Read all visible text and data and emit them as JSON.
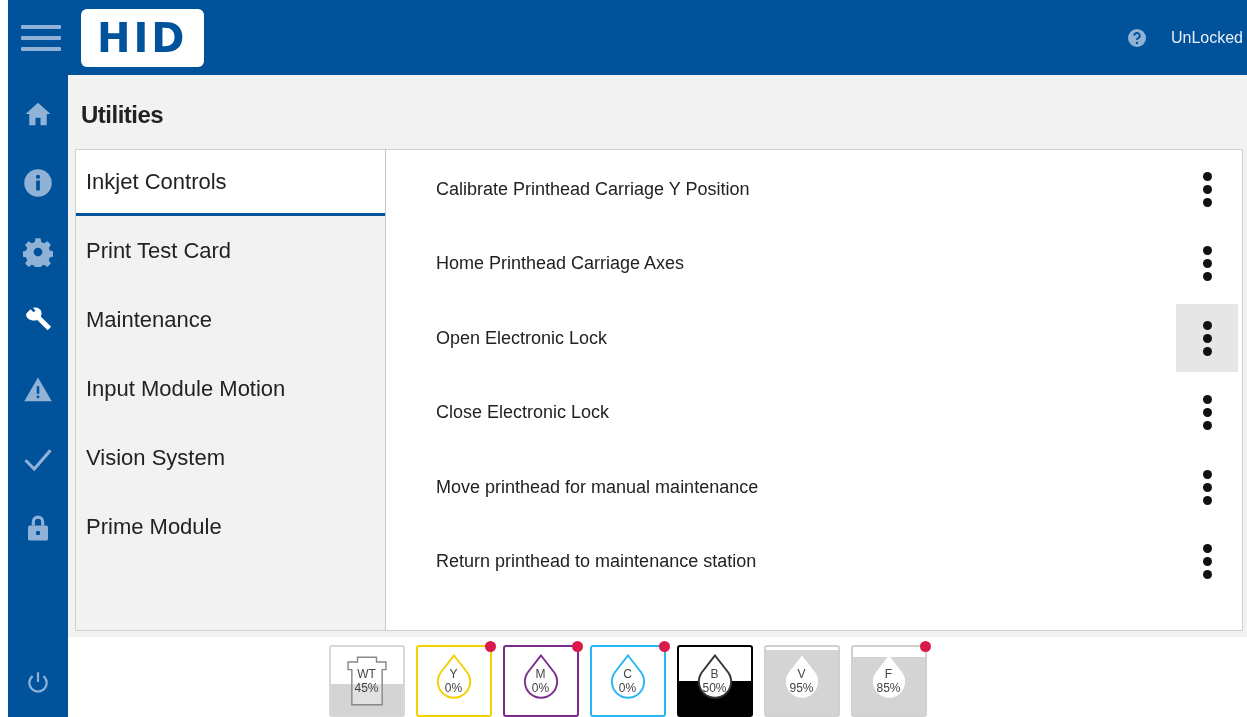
{
  "header": {
    "logo": "HID",
    "status": "UnLocked"
  },
  "sidebar": {
    "items": [
      {
        "kind": "home",
        "selected": false
      },
      {
        "kind": "info",
        "selected": false
      },
      {
        "kind": "settings",
        "selected": false
      },
      {
        "kind": "wrench",
        "selected": true
      },
      {
        "kind": "warning",
        "selected": false
      },
      {
        "kind": "check",
        "selected": false
      },
      {
        "kind": "lock",
        "selected": false
      }
    ]
  },
  "page": {
    "title": "Utilities"
  },
  "tabs": [
    {
      "label": "Inkjet Controls",
      "selected": true
    },
    {
      "label": "Print Test Card",
      "selected": false
    },
    {
      "label": "Maintenance",
      "selected": false
    },
    {
      "label": "Input Module Motion",
      "selected": false
    },
    {
      "label": "Vision System",
      "selected": false
    },
    {
      "label": "Prime Module",
      "selected": false
    }
  ],
  "actions": [
    {
      "label": "Calibrate Printhead Carriage Y Position",
      "hovered": false
    },
    {
      "label": "Home Printhead Carriage Axes",
      "hovered": false
    },
    {
      "label": "Open Electronic Lock",
      "hovered": true
    },
    {
      "label": "Close Electronic Lock",
      "hovered": false
    },
    {
      "label": "Move printhead for manual maintenance",
      "hovered": false
    },
    {
      "label": "Return printhead to maintenance station",
      "hovered": false
    }
  ],
  "supplies": [
    {
      "kind": "tank",
      "code": "WT",
      "reading": "45%",
      "color": "#d8d8d8",
      "alert": false
    },
    {
      "kind": "drop",
      "code": "Y",
      "reading": "0%",
      "color": "#f5d000",
      "alert": true
    },
    {
      "kind": "drop",
      "code": "M",
      "reading": "0%",
      "color": "#7b2d8e",
      "alert": true
    },
    {
      "kind": "drop",
      "code": "C",
      "reading": "0%",
      "color": "#29b6f6",
      "alert": true
    },
    {
      "kind": "drop",
      "code": "B",
      "reading": "50%",
      "color": "#000000",
      "alert": false
    },
    {
      "kind": "drop",
      "code": "V",
      "reading": "95%",
      "color": "#d0d0d0",
      "alert": false
    },
    {
      "kind": "drop",
      "code": "F",
      "reading": "85%",
      "color": "#d0d0d0",
      "alert": true
    }
  ]
}
